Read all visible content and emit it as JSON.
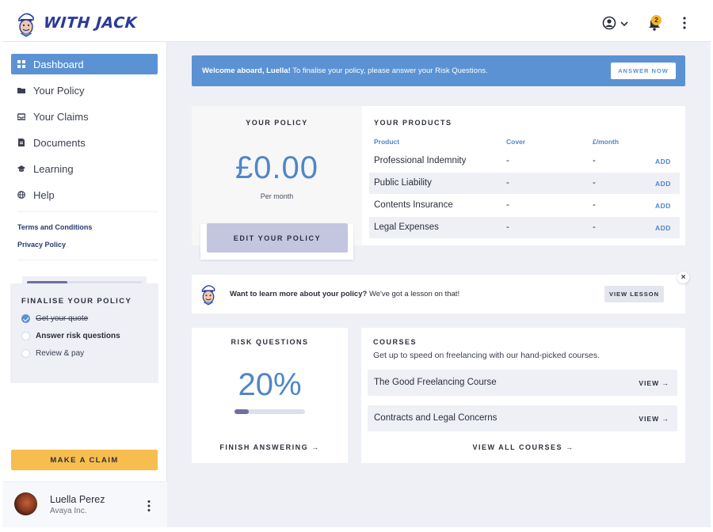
{
  "app": {
    "brand": "WITH JACK",
    "notification_count": "2"
  },
  "icons": {
    "logo": "mascot-logo",
    "user": "user-circle-icon",
    "chevron": "chevron-down-icon",
    "bell": "bell-icon",
    "kebab": "kebab-menu-icon"
  },
  "sidebar": {
    "items": [
      {
        "label": "Dashboard",
        "icon": "grid-icon",
        "active": true
      },
      {
        "label": "Your Policy",
        "icon": "folder-icon"
      },
      {
        "label": "Your Claims",
        "icon": "inbox-icon"
      },
      {
        "label": "Documents",
        "icon": "document-icon"
      },
      {
        "label": "Learning",
        "icon": "graduation-cap-icon"
      },
      {
        "label": "Help",
        "icon": "globe-icon"
      }
    ],
    "links": [
      "Terms and Conditions",
      "Privacy Policy"
    ],
    "finalise": {
      "title": "FINALISE YOUR POLICY",
      "progress": 0.35,
      "steps": [
        {
          "label": "Get your quote",
          "state": "done"
        },
        {
          "label": "Answer risk questions",
          "state": "current"
        },
        {
          "label": "Review & pay",
          "state": "todo"
        }
      ]
    },
    "claim_button": "MAKE A CLAIM",
    "user": {
      "name": "Luella Perez",
      "company": "Avaya Inc."
    }
  },
  "welcome": {
    "greeting": "Welcome aboard, Luella!",
    "message": " To finalise your policy, please answer your Risk Questions.",
    "button": "ANSWER NOW"
  },
  "policy": {
    "title": "YOUR POLICY",
    "price": "£0.00",
    "period": "Per month",
    "button": "EDIT YOUR POLICY"
  },
  "products": {
    "title": "YOUR PRODUCTS",
    "columns": [
      "Product",
      "Cover",
      "£/month"
    ],
    "rows": [
      {
        "name": "Professional Indemnity",
        "cover": "-",
        "monthly": "-",
        "action": "ADD"
      },
      {
        "name": "Public Liability",
        "cover": "-",
        "monthly": "-",
        "action": "ADD"
      },
      {
        "name": "Contents Insurance",
        "cover": "-",
        "monthly": "-",
        "action": "ADD"
      },
      {
        "name": "Legal Expenses",
        "cover": "-",
        "monthly": "-",
        "action": "ADD"
      }
    ]
  },
  "lesson": {
    "bold": "Want to learn more about your policy?",
    "rest": " We've got a lesson on that!",
    "button": "VIEW LESSON",
    "close": "×"
  },
  "risk": {
    "title": "RISK QUESTIONS",
    "percent": "20%",
    "progress": 0.2,
    "link": "FINISH ANSWERING →"
  },
  "courses": {
    "title": "COURSES",
    "subtitle": "Get up to speed on freelancing with our hand-picked courses.",
    "items": [
      {
        "name": "The Good Freelancing Course",
        "action": "VIEW →"
      },
      {
        "name": "Contracts and Legal Concerns",
        "action": "VIEW →"
      }
    ],
    "view_all": "VIEW ALL COURSES →"
  },
  "colors": {
    "accent": "#5b92d3",
    "claim": "#f7bd4f",
    "badge": "#f2b530",
    "button_muted": "#c4c6df"
  }
}
